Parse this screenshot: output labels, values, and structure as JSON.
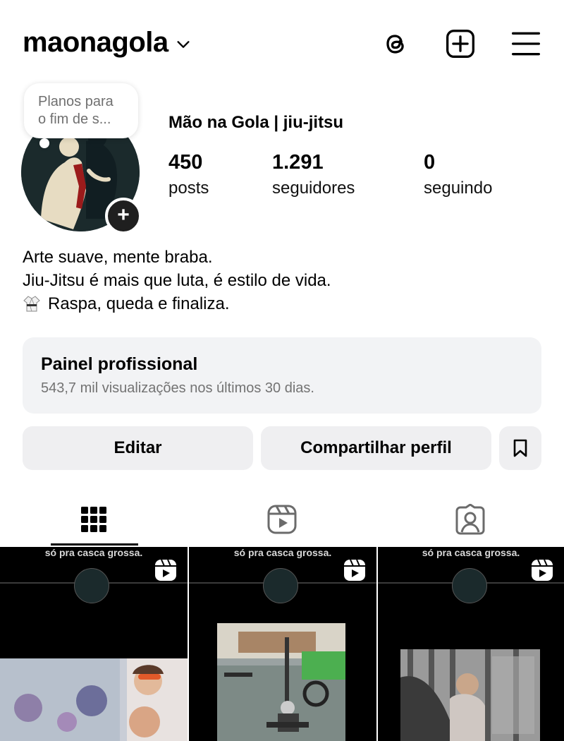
{
  "header": {
    "username": "maonagola",
    "icons": [
      "threads-icon",
      "plus-square-icon",
      "menu-icon"
    ]
  },
  "profile": {
    "note": "Planos para o fim de s...",
    "full_name": "Mão na Gola | jiu-jitsu",
    "stats": [
      {
        "value": "450",
        "label": "posts"
      },
      {
        "value": "1.291",
        "label": "seguidores"
      },
      {
        "value": "0",
        "label": "seguindo"
      }
    ],
    "bio": [
      "Arte suave, mente braba.",
      "Jiu-Jitsu é mais que luta, é estilo de vida.",
      "Raspa, queda e finaliza."
    ]
  },
  "panel": {
    "title": "Painel profissional",
    "subtitle": "543,7 mil visualizações nos últimos 30 dias."
  },
  "buttons": {
    "edit": "Editar",
    "share": "Compartilhar perfil"
  },
  "tabs": [
    "grid-icon",
    "reels-icon",
    "tagged-icon"
  ],
  "grid": [
    {
      "caption": "só pra casca grossa."
    },
    {
      "caption": "só pra casca grossa."
    },
    {
      "caption": "só pra casca grossa."
    }
  ],
  "colors": {
    "panel_bg": "#f2f3f5",
    "button_bg": "#efeff1",
    "muted_text": "#737373"
  }
}
